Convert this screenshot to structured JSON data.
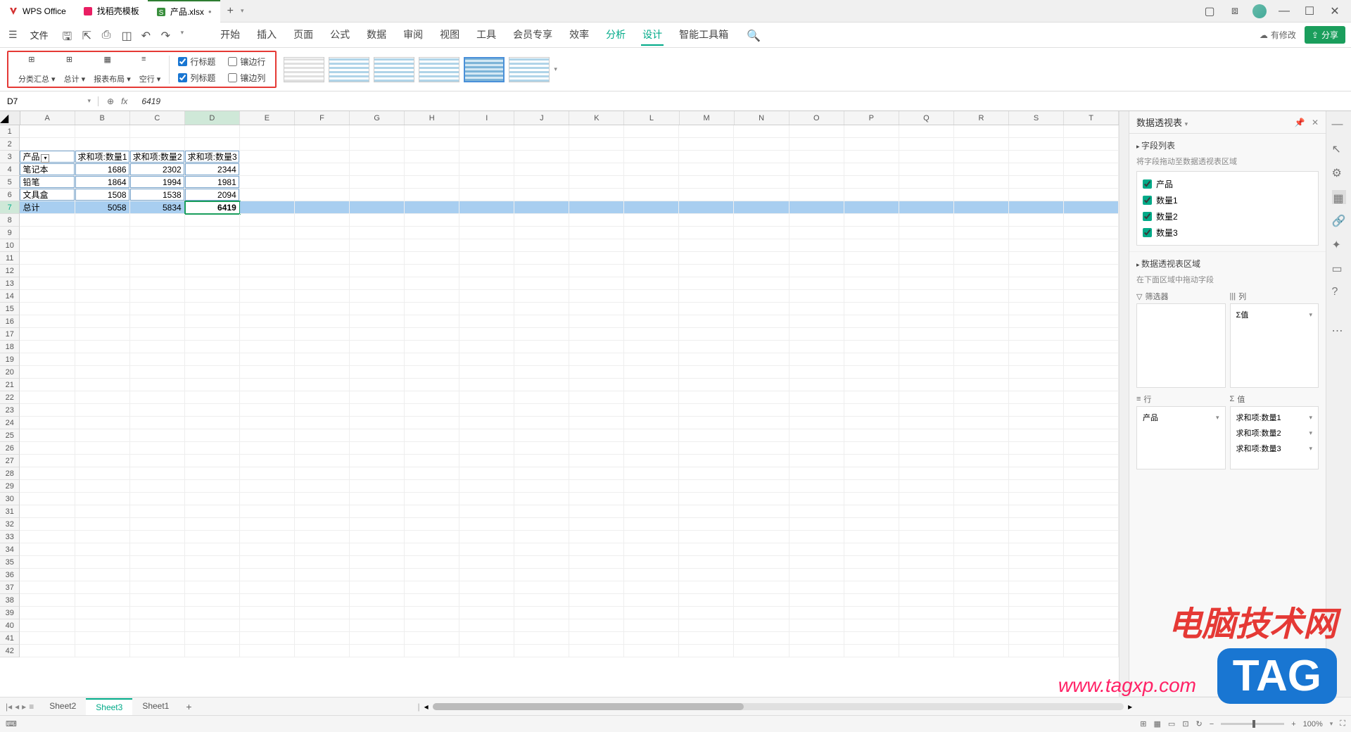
{
  "titlebar": {
    "wps_label": "WPS Office",
    "template_label": "找稻壳模板",
    "file_label": "产品.xlsx",
    "add_tab": "+"
  },
  "menubar": {
    "file": "文件",
    "tabs": [
      "开始",
      "插入",
      "页面",
      "公式",
      "数据",
      "审阅",
      "视图",
      "工具",
      "会员专享",
      "效率",
      "分析",
      "设计",
      "智能工具箱"
    ],
    "active_tab_index": 11,
    "green_tab_indexes": [
      10,
      11
    ],
    "cloud": "有修改",
    "share": "分享"
  },
  "ribbon": {
    "group_btns": [
      "分类汇总",
      "总计",
      "报表布局",
      "空行"
    ],
    "checks": {
      "row_header": "行标题",
      "col_header": "列标题",
      "banded_row": "镶边行",
      "banded_col": "镶边列",
      "row_header_checked": true,
      "col_header_checked": true,
      "banded_row_checked": false,
      "banded_col_checked": false
    }
  },
  "formula_bar": {
    "name_box": "D7",
    "formula": "6419"
  },
  "sheet": {
    "columns": [
      "A",
      "B",
      "C",
      "D",
      "E",
      "F",
      "G",
      "H",
      "I",
      "J",
      "K",
      "L",
      "M",
      "N",
      "O",
      "P",
      "Q",
      "R",
      "S",
      "T"
    ],
    "active_col": "D",
    "row_count": 42,
    "active_row": 7,
    "headers": {
      "A": "产品",
      "B": "求和项:数量1",
      "C": "求和项:数量2",
      "D": "求和项:数量3"
    },
    "data": [
      {
        "A": "笔记本",
        "B": "1686",
        "C": "2302",
        "D": "2344"
      },
      {
        "A": "铅笔",
        "B": "1864",
        "C": "1994",
        "D": "1981"
      },
      {
        "A": "文具盒",
        "B": "1508",
        "C": "1538",
        "D": "2094"
      }
    ],
    "total": {
      "A": "总计",
      "B": "5058",
      "C": "5834",
      "D": "6419"
    }
  },
  "pivot": {
    "title": "数据透视表",
    "section_fields": "字段列表",
    "drag_hint": "将字段拖动至数据透视表区域",
    "fields": [
      "产品",
      "数量1",
      "数量2",
      "数量3"
    ],
    "section_areas": "数据透视表区域",
    "area_hint": "在下面区域中拖动字段",
    "labels": {
      "filter": "筛选器",
      "column": "列",
      "row": "行",
      "value": "值"
    },
    "column_items": [
      "Σ值"
    ],
    "row_items": [
      "产品"
    ],
    "value_items": [
      "求和项:数量1",
      "求和项:数量2",
      "求和项:数量3"
    ]
  },
  "sheet_tabs": {
    "sheets": [
      "Sheet2",
      "Sheet3",
      "Sheet1"
    ],
    "active_index": 1,
    "add": "+"
  },
  "statusbar": {
    "zoom": "100%"
  },
  "watermark": {
    "cn": "电脑技术网",
    "url": "www.tagxp.com",
    "tag": "TAG"
  }
}
